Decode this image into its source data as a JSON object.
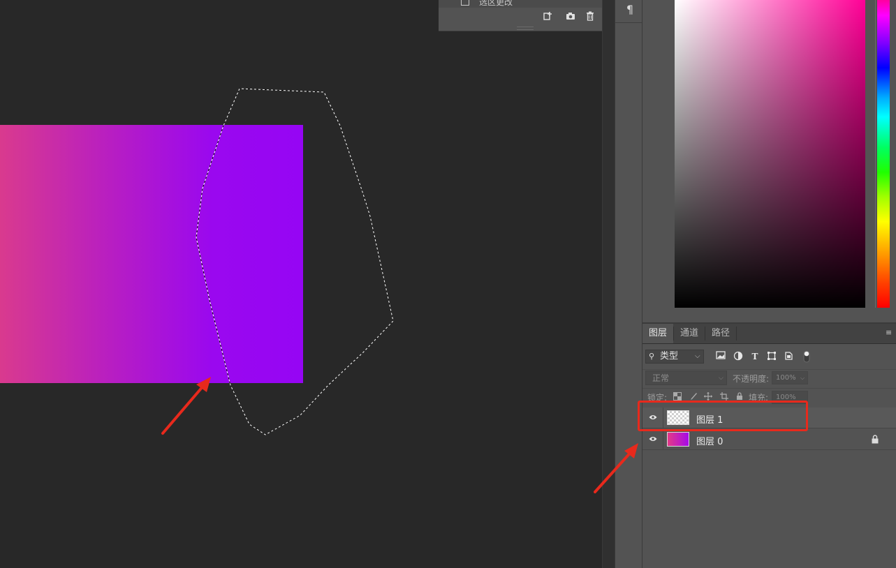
{
  "history": {
    "partial_row_label": "选区更改",
    "tools": [
      "new-document-from-state-icon",
      "snapshot-icon",
      "trash-icon"
    ]
  },
  "dock": {
    "paragraph_icon": "¶"
  },
  "layers_panel": {
    "tabs": [
      {
        "label": "图层",
        "active": true
      },
      {
        "label": "通道",
        "active": false
      },
      {
        "label": "路径",
        "active": false
      }
    ],
    "menu_icon": "≡",
    "filter": {
      "icon": "⚲",
      "label": "类型",
      "arrow": "⌵"
    },
    "filter_icons": [
      "image-filter-icon",
      "adjustment-filter-icon",
      "type-filter-icon",
      "shape-filter-icon",
      "smart-object-filter-icon",
      "filter-toggle-icon"
    ],
    "blend_mode": "正常",
    "opacity_label": "不透明度:",
    "opacity_value": "100%",
    "lock_label": "锁定:",
    "fill_label": "填充:",
    "fill_value": "100%",
    "layers": [
      {
        "name": "图层 1",
        "visible": true,
        "selected": true,
        "thumbnail": "transparent",
        "locked": false
      },
      {
        "name": "图层 0",
        "visible": true,
        "selected": false,
        "thumbnail": "gradient",
        "locked": true
      }
    ]
  },
  "colors": {
    "gradient_start": "#d93a8e",
    "gradient_end": "#9605f4",
    "annotation_red": "#e8291c",
    "panel_bg": "#535353",
    "canvas_bg": "#282828"
  }
}
